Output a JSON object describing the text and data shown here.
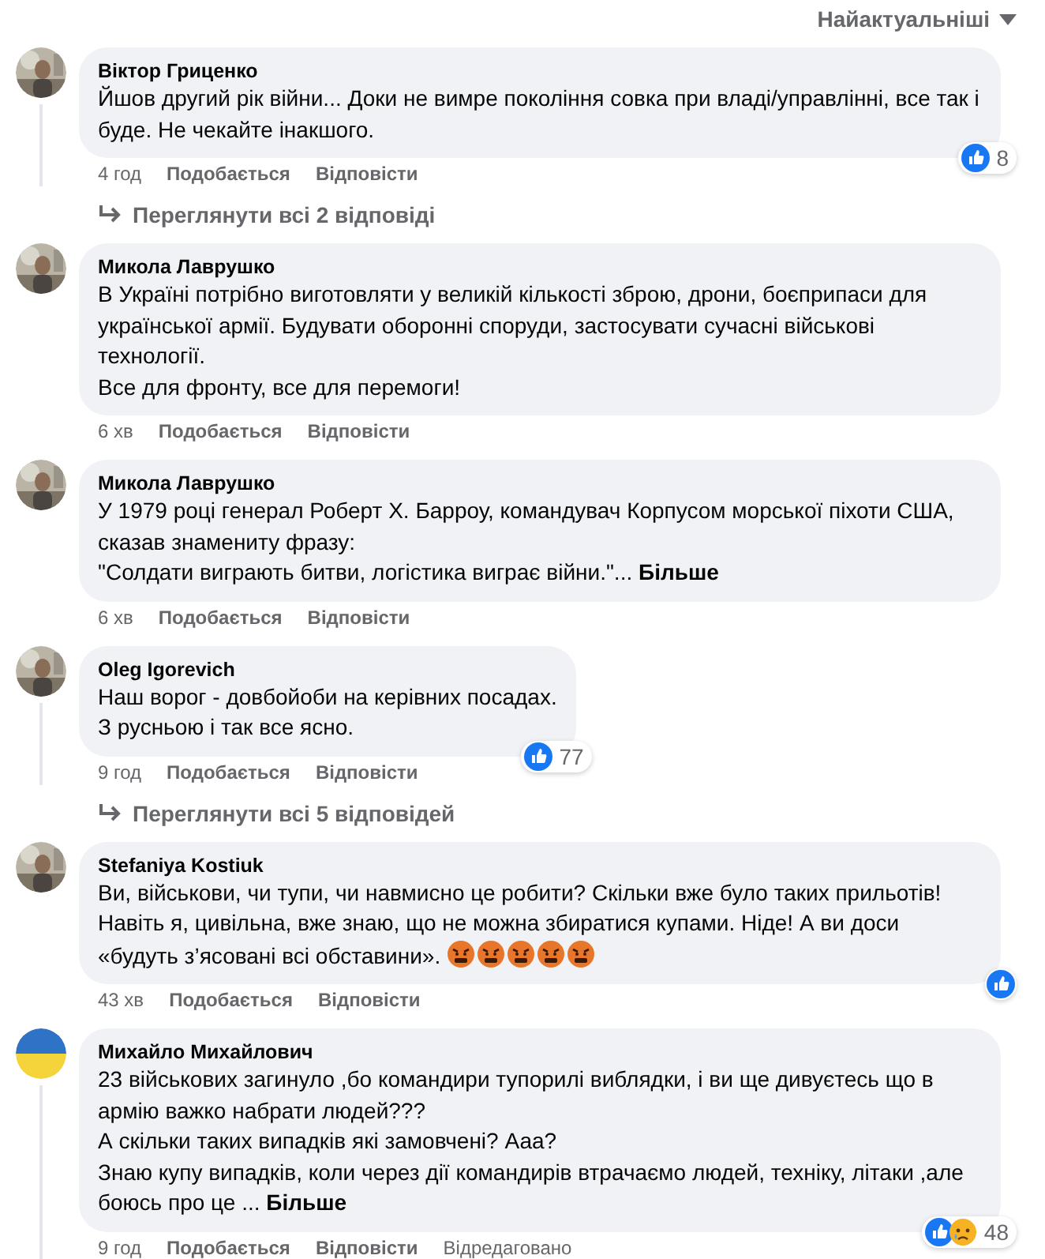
{
  "sort_menu": {
    "label": "Найактуальніші"
  },
  "comments": [
    {
      "author": "Віктор Гриценко",
      "avatar": {
        "kind": "picture"
      },
      "text": "Йшов другий рік війни... Доки не вимре покоління совка при владі/управлінні, все так і буде. Не чекайте інакшого.",
      "time": "4 год",
      "like": "Подобається",
      "reply": "Відповісти",
      "reactions": {
        "icons": [
          {
            "kind": "like"
          }
        ],
        "count": "8"
      },
      "replies_link": "Переглянути всі 2 відповіді",
      "thread": true
    },
    {
      "author": "Микола Лаврушко",
      "avatar": {
        "kind": "picture"
      },
      "text": "В Україні потрібно виготовляти у великій кількості зброю, дрони, боєприпаси для української армії. Будувати оборонні споруди, застосувати сучасні військові технології.\nВсе для фронту, все для перемоги!",
      "time": "6 хв",
      "like": "Подобається",
      "reply": "Відповісти",
      "thread": false
    },
    {
      "author": "Микола Лаврушко",
      "avatar": {
        "kind": "picture"
      },
      "text": "У 1979 році генерал Роберт Х. Барроу, командувач Корпусом морської піхоти США, сказав знамениту фразу:\n\"Солдати виграють битви, логістика виграє війни.\"...",
      "more": "Більше",
      "time": "6 хв",
      "like": "Подобається",
      "reply": "Відповісти",
      "thread": false
    },
    {
      "author": "Oleg Igorevich",
      "avatar": {
        "kind": "picture"
      },
      "text": "Наш ворог - довбойоби на керівних посадах.\nЗ русньою і так все ясно.",
      "time": "9 год",
      "like": "Подобається",
      "reply": "Відповісти",
      "reactions": {
        "icons": [
          {
            "kind": "like"
          }
        ],
        "count": "77"
      },
      "replies_link": "Переглянути всі 5 відповідей",
      "thread": true
    },
    {
      "author": "Stefaniya Kostiuk",
      "avatar": {
        "kind": "picture"
      },
      "text": "Ви, військови, чи тупи, чи навмисно це робити? Скільки вже було таких прильотів! Навіть я, цивільна, вже знаю, що не можна збиратися купами. Ніде! А ви доси «будуть з’ясовані всі обставини».",
      "emojis": [
        {
          "kind": "angry-face"
        },
        {
          "kind": "angry-face"
        },
        {
          "kind": "angry-face"
        },
        {
          "kind": "angry-face"
        },
        {
          "kind": "angry-face"
        }
      ],
      "time": "43 хв",
      "like": "Подобається",
      "reply": "Відповісти",
      "reactions": {
        "icons": [
          {
            "kind": "like"
          }
        ]
      },
      "thread": false
    },
    {
      "author": "Михайло Михайлович",
      "avatar": {
        "kind": "flag"
      },
      "text": "23 військових загинуло ,бо командири тупорилі виблядки, і ви ще дивуєтесь що в армію важко набрати людей???\nА скільки таких випадків які замовчені? Ааа?\nЗнаю купу випадків, коли через дії командирів втрачаємо людей, техніку, літаки ,але боюсь про це ...",
      "more": "Більше",
      "time": "9 год",
      "like": "Подобається",
      "reply": "Відповісти",
      "edited": "Відредаговано",
      "reactions": {
        "icons": [
          {
            "kind": "like"
          },
          {
            "kind": "sad"
          }
        ],
        "count": "48"
      },
      "thread": true
    }
  ]
}
